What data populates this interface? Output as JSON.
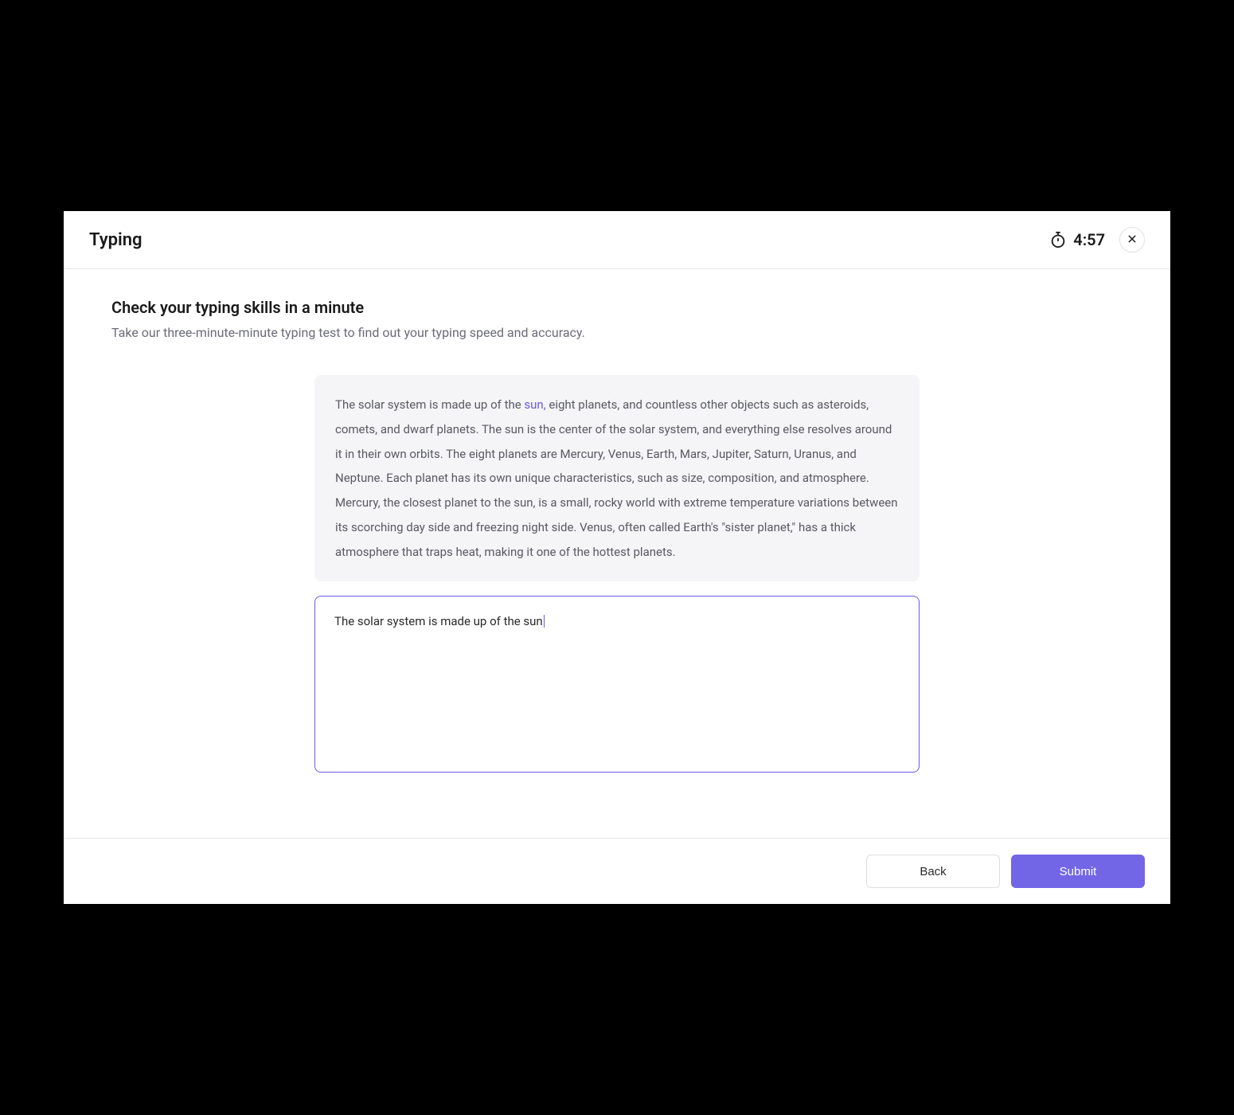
{
  "header": {
    "title": "Typing",
    "timer": "4:57"
  },
  "body": {
    "heading": "Check your typing skills in a minute",
    "subheading": "Take our three-minute-minute typing test to find out your typing speed and accuracy.",
    "passage_before": "The solar system is made up of the ",
    "passage_highlight": "sun,",
    "passage_after": " eight planets, and countless other objects such as asteroids, comets, and dwarf planets. The sun is the center of the solar system, and everything else resolves around it in their own orbits. The eight planets are Mercury, Venus, Earth, Mars, Jupiter, Saturn, Uranus, and Neptune. Each planet has its own unique characteristics, such as size, composition, and atmosphere. Mercury, the closest planet to the sun, is a small, rocky world with extreme temperature variations between its scorching day side and freezing night side. Venus, often called Earth's \"sister planet,\" has a thick atmosphere that traps heat, making it one of the hottest planets.",
    "typed_value": "The solar system is made up of the sun"
  },
  "footer": {
    "back_label": "Back",
    "submit_label": "Submit"
  }
}
